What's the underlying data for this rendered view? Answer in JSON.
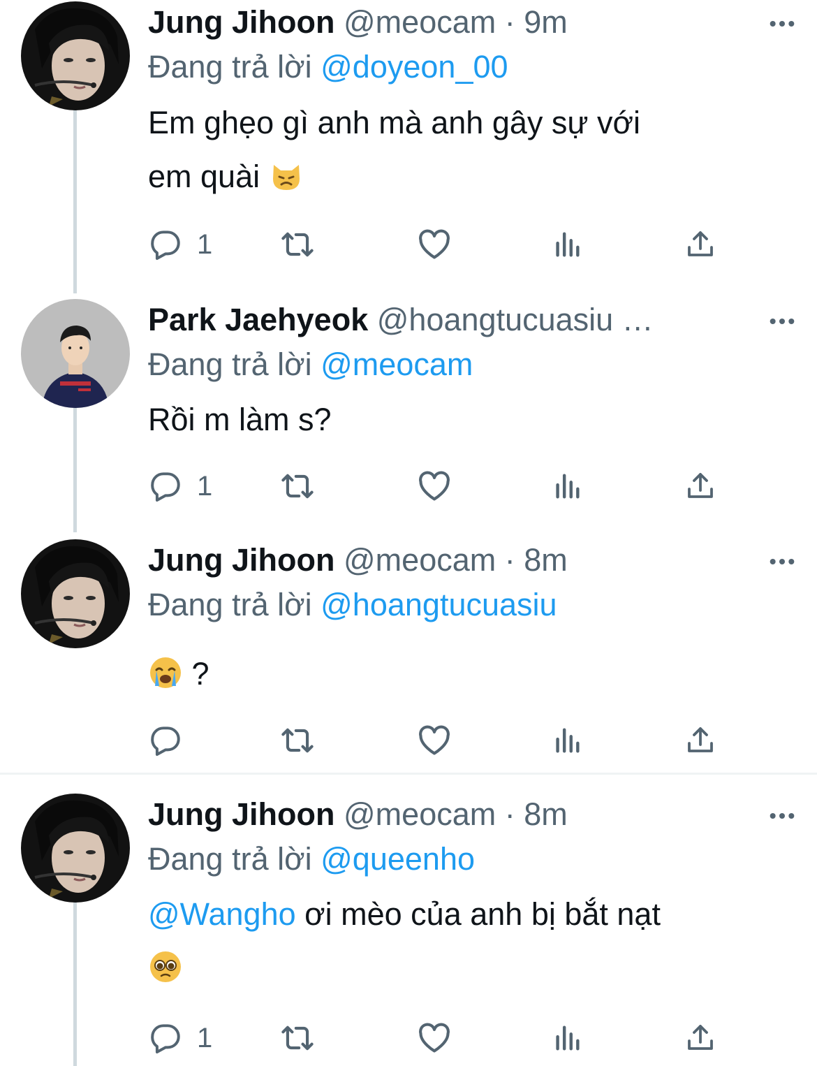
{
  "replying_prefix": "Đang trả lời",
  "colors": {
    "accent": "#1d9bf0",
    "secondary": "#536471",
    "thread_line": "#cfd9de"
  },
  "tweets": [
    {
      "name": "Jung Jihoon",
      "handle": "@meocam",
      "dot": "·",
      "time": "9m",
      "reply_to": "@doyeon_00",
      "text_line1": "Em ghẹo gì anh mà anh gây sự với",
      "text_line2": "em quài",
      "emoji": "cat-pouting-icon",
      "reply_count": "1"
    },
    {
      "name": "Park Jaehyeok",
      "handle": "@hoangtucuasiu …",
      "reply_to": "@meocam",
      "text_line1": "Rồi m làm s?",
      "reply_count": "1"
    },
    {
      "name": "Jung Jihoon",
      "handle": "@meocam",
      "dot": "·",
      "time": "8m",
      "reply_to": "@hoangtucuasiu",
      "text_after_emoji": "?",
      "emoji": "crying-face-icon",
      "reply_count": ""
    },
    {
      "name": "Jung Jihoon",
      "handle": "@meocam",
      "dot": "·",
      "time": "8m",
      "reply_to": "@queenho",
      "mention": "@Wangho",
      "text_line1_rest": " ơi mèo của anh bị bắt nạt",
      "emoji": "pleading-face-icon",
      "reply_count": "1"
    }
  ]
}
